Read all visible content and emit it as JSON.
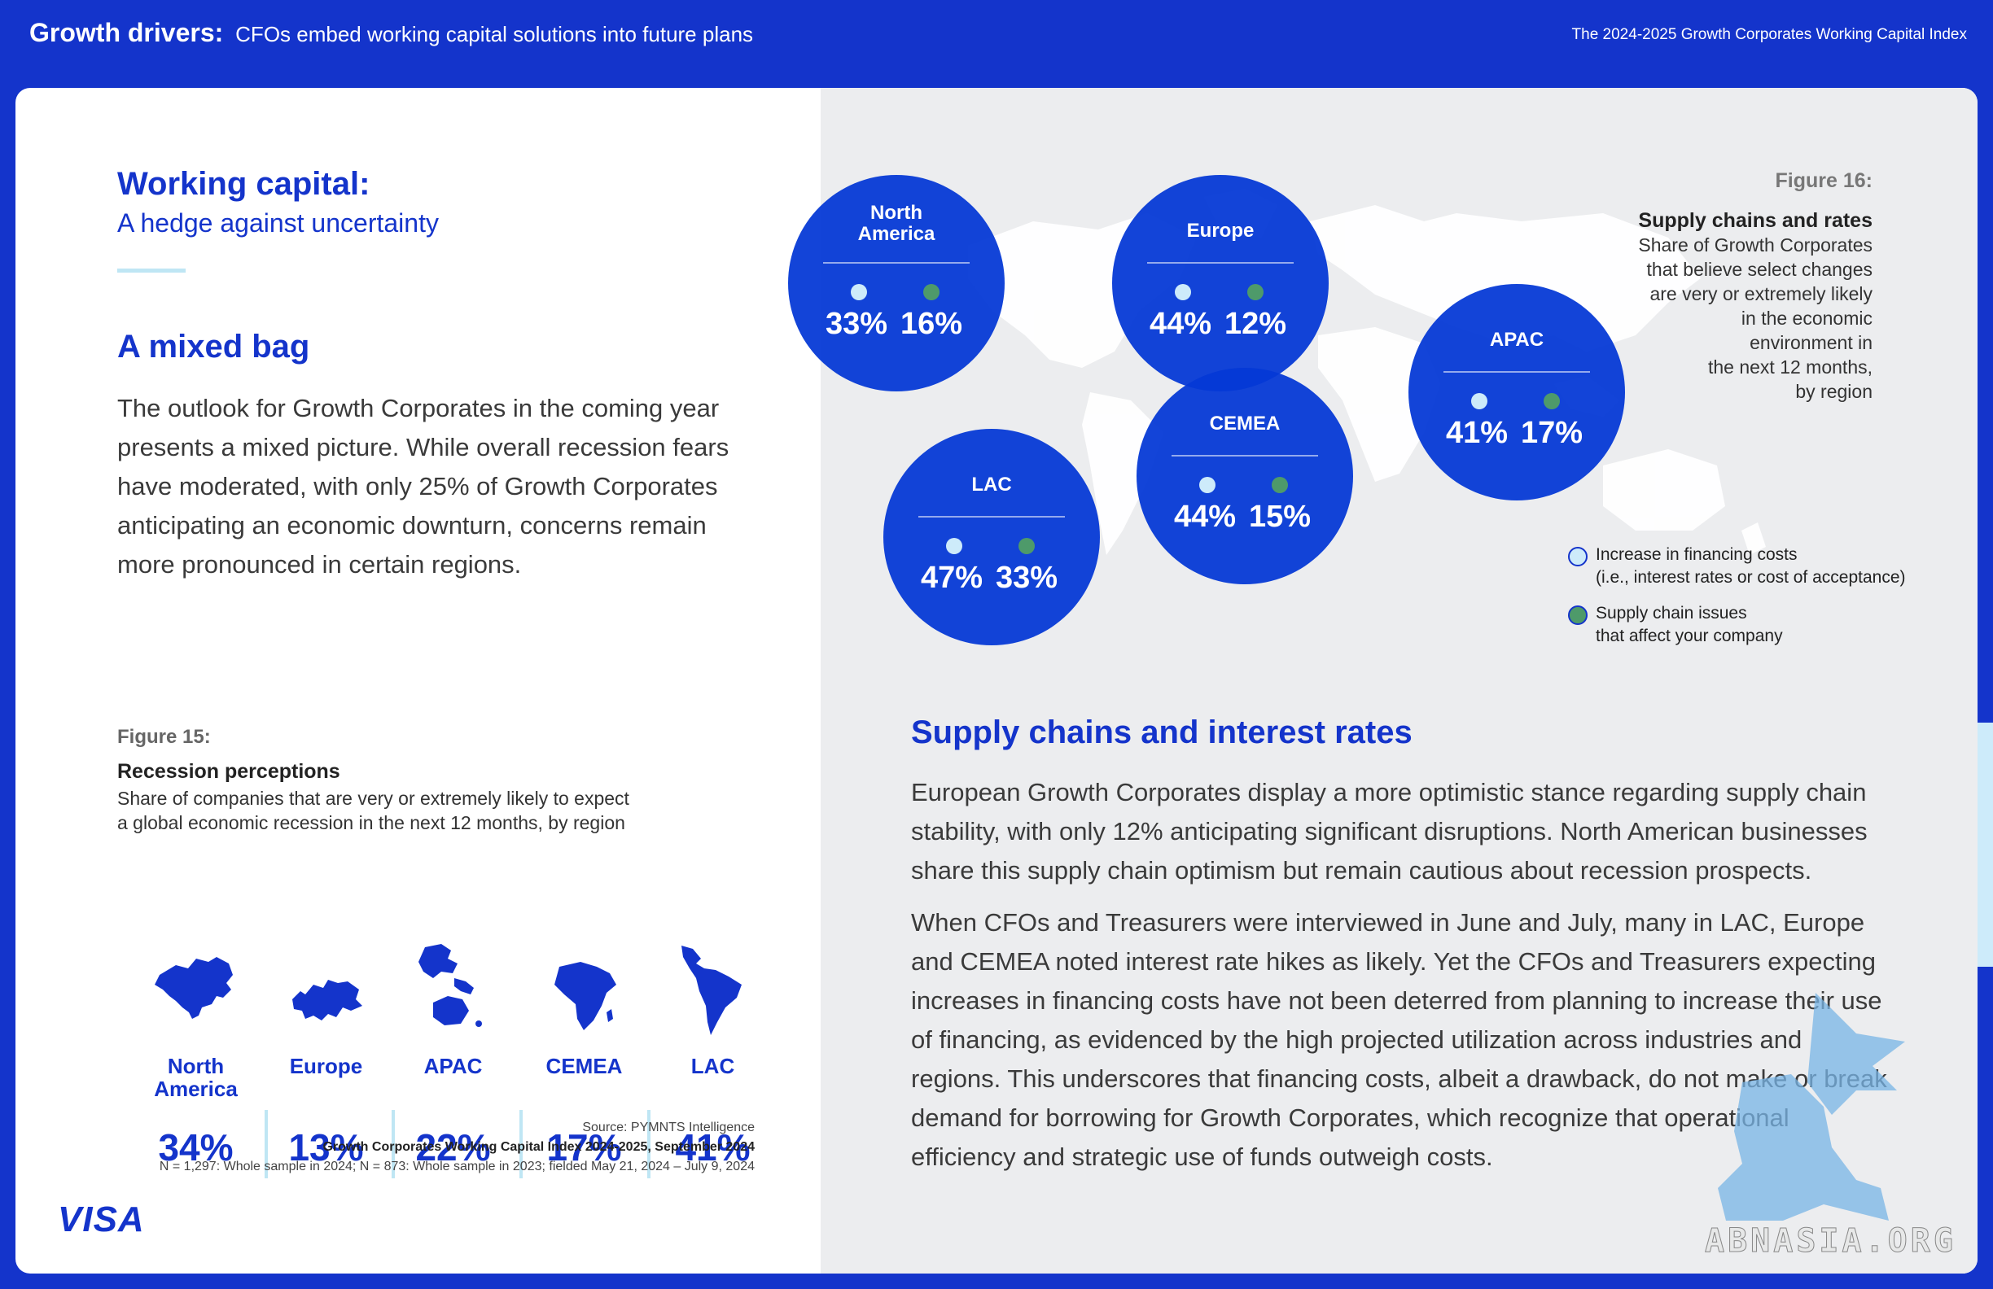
{
  "header": {
    "title_bold": "Growth drivers:",
    "title_rest": "CFOs embed working capital solutions into future plans",
    "index_name": "The 2024-2025 Growth Corporates Working Capital Index"
  },
  "left": {
    "wc_title": "Working capital:",
    "wc_subtitle": "A hedge against uncertainty",
    "mixed_title": "A mixed bag",
    "mixed_body": "The outlook for Growth Corporates in the coming year presents a mixed picture. While overall recession fears have moderated, with only 25% of Growth Corporates anticipating an economic downturn, concerns remain more pronounced in certain regions."
  },
  "fig15": {
    "label": "Figure 15:",
    "title": "Recession perceptions",
    "desc_line1": "Share of companies that are very or extremely likely to expect",
    "desc_line2": "a global economic recession in the next 12 months, by region",
    "regions": [
      {
        "name_line1": "North",
        "name_line2": "America",
        "value": "34%",
        "icon": "north-america-map-icon"
      },
      {
        "name_line1": "Europe",
        "name_line2": "",
        "value": "13%",
        "icon": "europe-map-icon"
      },
      {
        "name_line1": "APAC",
        "name_line2": "",
        "value": "22%",
        "icon": "apac-map-icon"
      },
      {
        "name_line1": "CEMEA",
        "name_line2": "",
        "value": "17%",
        "icon": "cemea-map-icon"
      },
      {
        "name_line1": "LAC",
        "name_line2": "",
        "value": "41%",
        "icon": "lac-map-icon"
      }
    ],
    "source_line1": "Source: PYMNTS Intelligence",
    "source_line2": "Growth Corporates Working Capital Index 2024-2025, September 2024",
    "source_line3": "N = 1,297: Whole sample in 2024; N = 873: Whole sample in  2023; fielded May 21, 2024 – July 9, 2024"
  },
  "brand": {
    "logo": "VISA"
  },
  "fig16": {
    "label": "Figure 16:",
    "title": "Supply chains and rates",
    "desc": [
      "Share of Growth Corporates",
      "that believe select changes",
      "are very or extremely likely",
      "in the economic",
      "environment in",
      "the next 12 months,",
      "by region"
    ],
    "bubbles": [
      {
        "name_line1": "North",
        "name_line2": "America",
        "financing": "33%",
        "supply": "16%"
      },
      {
        "name_line1": "Europe",
        "name_line2": "",
        "financing": "44%",
        "supply": "12%"
      },
      {
        "name_line1": "APAC",
        "name_line2": "",
        "financing": "41%",
        "supply": "17%"
      },
      {
        "name_line1": "CEMEA",
        "name_line2": "",
        "financing": "44%",
        "supply": "15%"
      },
      {
        "name_line1": "LAC",
        "name_line2": "",
        "financing": "47%",
        "supply": "33%"
      }
    ],
    "legend": {
      "financing_line1": "Increase in financing costs",
      "financing_line2": "(i.e., interest rates or cost  of acceptance)",
      "supply_line1": "Supply chain issues",
      "supply_line2": "that affect your company"
    },
    "colors": {
      "financing": "#CDEBFA",
      "supply": "#4E9A6A",
      "bubble": "#0438D6"
    }
  },
  "supply_section": {
    "title": "Supply chains and interest rates",
    "para1": "European Growth Corporates display a more optimistic stance regarding supply chain stability, with only 12% anticipating significant disruptions. North American businesses share this supply chain optimism but remain cautious about recession prospects.",
    "para2": "When CFOs and Treasurers were interviewed in June and July, many in LAC, Europe and CEMEA noted interest rate hikes as likely. Yet the CFOs and Treasurers expecting increases in financing costs have not been deterred from planning to increase their use of financing, as evidenced by the high projected utilization across industries and regions. This underscores that financing costs, albeit a drawback, do not make or break demand for borrowing for  Growth Corporates, which recognize that operational efficiency and strategic use of funds outweigh costs."
  },
  "watermark": {
    "text": "ABNASIA.ORG"
  },
  "colors": {
    "brand_blue": "#1434CB",
    "panel_gray": "#ECEDEF",
    "accent_light": "#BFE6F4"
  }
}
